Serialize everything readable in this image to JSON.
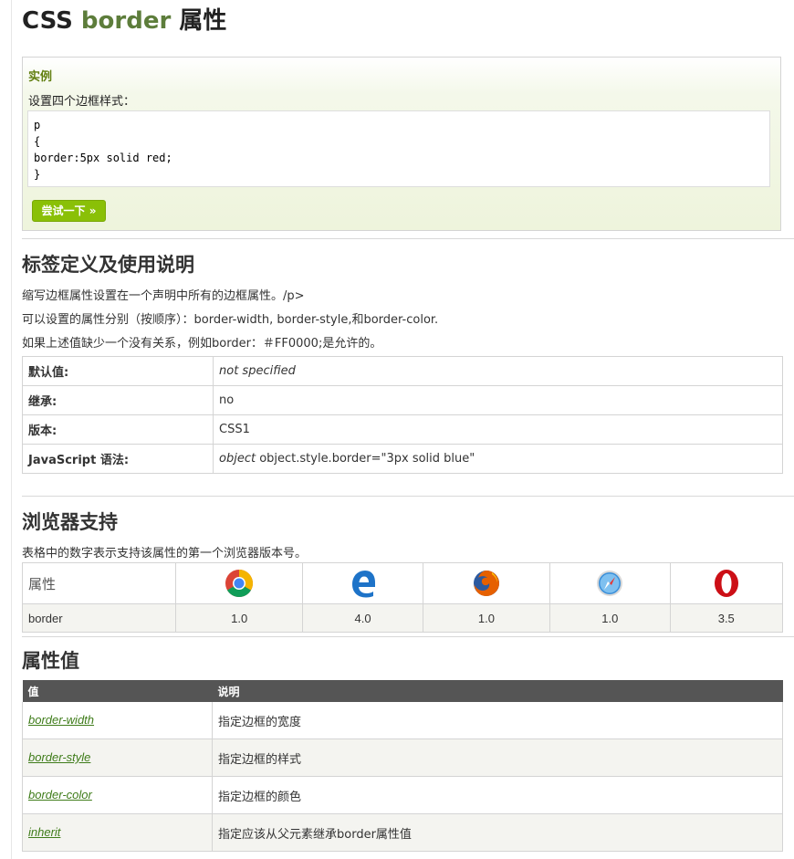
{
  "heading": {
    "prefix": "CSS ",
    "keyword": "border",
    "suffix": " 属性"
  },
  "example": {
    "title": "实例",
    "description": "设置四个边框样式：",
    "code": "p\n{\nborder:5px solid red;\n}",
    "try_button": "尝试一下 »"
  },
  "definition": {
    "title": "标签定义及使用说明",
    "lines": [
      "缩写边框属性设置在一个声明中所有的边框属性。/p>",
      "可以设置的属性分别（按顺序）：border-width, border-style,和border-color.",
      "如果上述值缺少一个没有关系，例如border：＃FF0000;是允许的。"
    ]
  },
  "props": [
    {
      "key": "默认值:",
      "value_italic": "not specified",
      "value": ""
    },
    {
      "key": "继承:",
      "value_italic": "",
      "value": "no"
    },
    {
      "key": "版本:",
      "value_italic": "",
      "value": "CSS1"
    },
    {
      "key": "JavaScript 语法:",
      "value_italic": "object",
      "value": " object.style.border=\"3px solid blue\""
    }
  ],
  "browser_support": {
    "title": "浏览器支持",
    "description": "表格中的数字表示支持该属性的第一个浏览器版本号。",
    "header_label": "属性",
    "browsers": [
      "chrome-icon",
      "edge-icon",
      "firefox-icon",
      "safari-icon",
      "opera-icon"
    ],
    "row_label": "border",
    "versions": [
      "1.0",
      "4.0",
      "1.0",
      "1.0",
      "3.5"
    ]
  },
  "values": {
    "title": "属性值",
    "col_value": "值",
    "col_desc": "说明",
    "rows": [
      {
        "value": "border-width",
        "desc": "指定边框的宽度"
      },
      {
        "value": "border-style",
        "desc": "指定边框的样式"
      },
      {
        "value": "border-color",
        "desc": "指定边框的颜色"
      },
      {
        "value": "inherit",
        "desc": "指定应该从父元素继承border属性值"
      }
    ]
  },
  "colors": {
    "accent": "#8ac007",
    "keyword": "#5d7d3b",
    "table_header": "#555555"
  }
}
